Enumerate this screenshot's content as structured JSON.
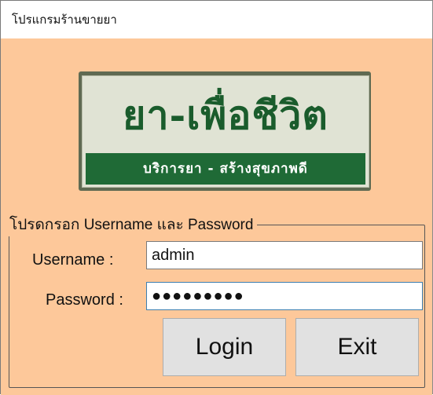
{
  "window": {
    "title": "โปรแกรมร้านขายยา"
  },
  "logo": {
    "main_text": "ยา-เพื่อชีวิต",
    "sub_text": "บริการยา - สร้างสุขภาพดี"
  },
  "login_group": {
    "legend": "โปรดกรอก Username และ Password",
    "username": {
      "label": "Username :",
      "value": "admin"
    },
    "password": {
      "label": "Password :",
      "value": "●●●●●●●●●"
    },
    "login_label": "Login",
    "exit_label": "Exit"
  },
  "colors": {
    "background": "#fdc89a",
    "button": "#e1e1e1",
    "focus_border": "#3c7fb1"
  }
}
